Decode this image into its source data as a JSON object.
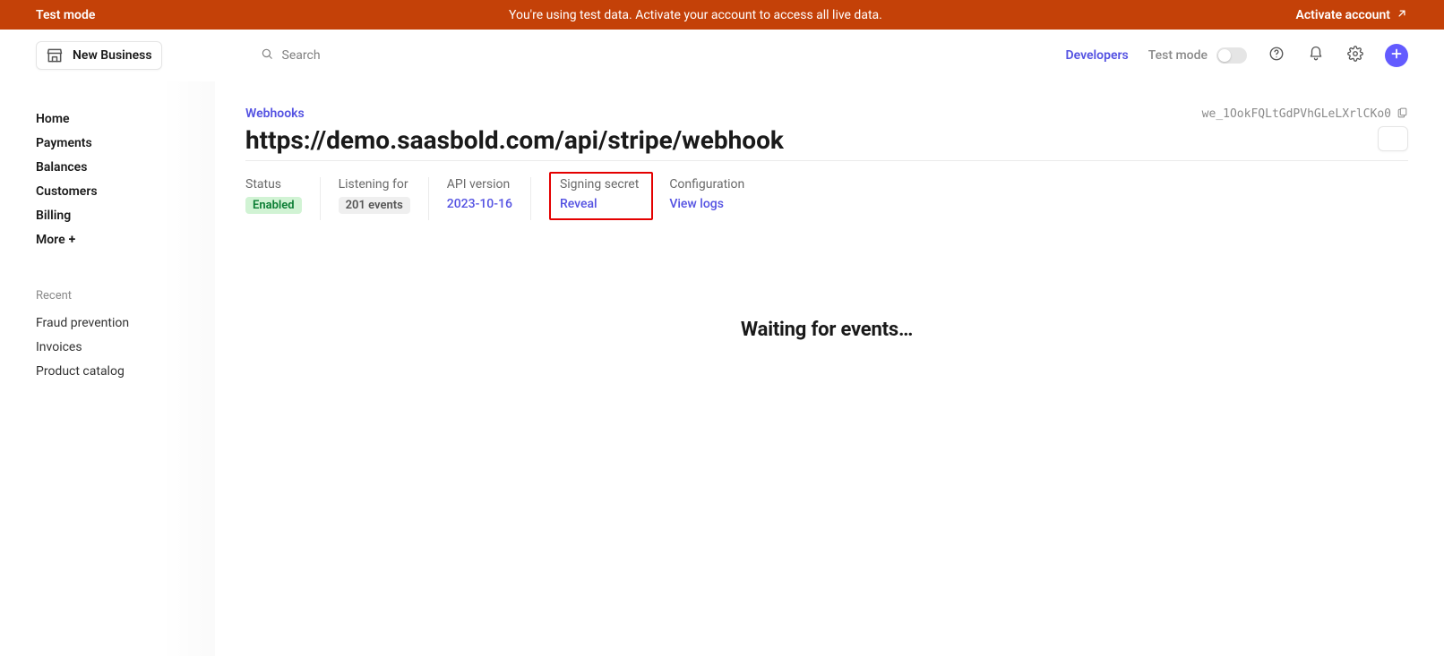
{
  "banner": {
    "left": "Test mode",
    "center": "You're using test data. Activate your account to access all live data.",
    "right": "Activate account"
  },
  "header": {
    "business_name": "New Business",
    "search_placeholder": "Search",
    "developers_label": "Developers",
    "test_mode_label": "Test mode"
  },
  "sidebar": {
    "items": [
      {
        "label": "Home"
      },
      {
        "label": "Payments"
      },
      {
        "label": "Balances"
      },
      {
        "label": "Customers"
      },
      {
        "label": "Billing"
      },
      {
        "label": "More"
      }
    ],
    "recent_label": "Recent",
    "recent": [
      {
        "label": "Fraud prevention"
      },
      {
        "label": "Invoices"
      },
      {
        "label": "Product catalog"
      }
    ]
  },
  "main": {
    "breadcrumb": "Webhooks",
    "title": "https://demo.saasbold.com/api/stripe/webhook",
    "webhook_id": "we_1OokFQLtGdPVhGLeLXrlCKo0",
    "info": {
      "status_label": "Status",
      "status_value": "Enabled",
      "listening_label": "Listening for",
      "listening_value": "201 events",
      "api_label": "API version",
      "api_value": "2023-10-16",
      "secret_label": "Signing secret",
      "secret_value": "Reveal",
      "config_label": "Configuration",
      "config_value": "View logs"
    },
    "waiting_text": "Waiting for events…"
  }
}
